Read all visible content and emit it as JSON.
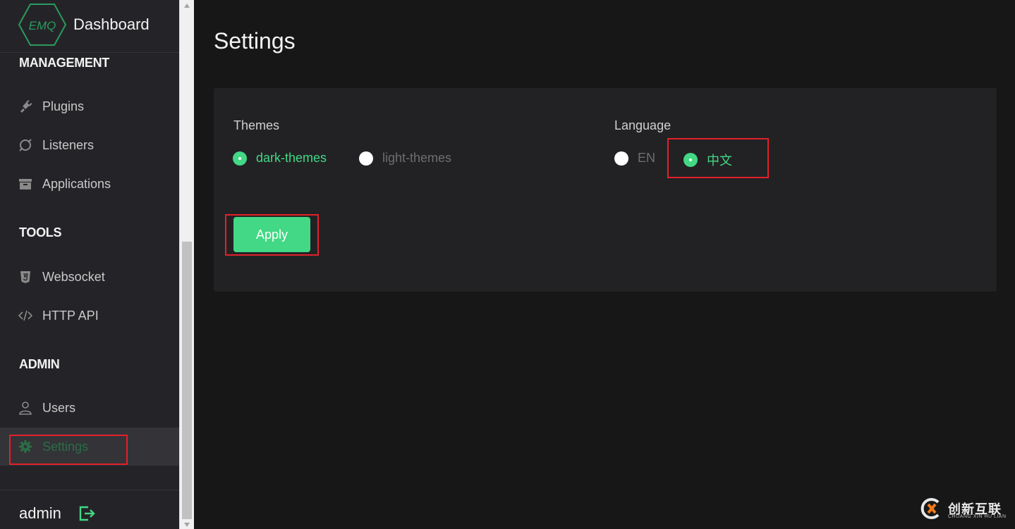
{
  "brand": {
    "logo_text": "EMQ",
    "title": "Dashboard"
  },
  "sidebar": {
    "groups": [
      {
        "title": "MANAGEMENT",
        "items": [
          {
            "label": "Plugins",
            "icon": "plug-icon"
          },
          {
            "label": "Listeners",
            "icon": "listener-icon"
          },
          {
            "label": "Applications",
            "icon": "archive-icon"
          }
        ]
      },
      {
        "title": "TOOLS",
        "items": [
          {
            "label": "Websocket",
            "icon": "html5-icon"
          },
          {
            "label": "HTTP API",
            "icon": "code-icon"
          }
        ]
      },
      {
        "title": "ADMIN",
        "items": [
          {
            "label": "Users",
            "icon": "user-icon"
          },
          {
            "label": "Settings",
            "icon": "gear-icon",
            "active": true
          }
        ]
      }
    ],
    "footer": {
      "username": "admin"
    }
  },
  "main": {
    "title": "Settings",
    "themes": {
      "label": "Themes",
      "options": [
        {
          "label": "dark-themes",
          "selected": true
        },
        {
          "label": "light-themes",
          "selected": false
        }
      ]
    },
    "language": {
      "label": "Language",
      "options": [
        {
          "label": "EN",
          "selected": false
        },
        {
          "label": "中文",
          "selected": true
        }
      ]
    },
    "apply_label": "Apply"
  },
  "watermark": {
    "text": "创新互联",
    "sub": "CHUANG XIN HU LIAN"
  },
  "colors": {
    "accent": "#42d885",
    "sidebar_bg": "#242428",
    "page_bg": "#171717",
    "card_bg": "#222224",
    "highlight": "#e3202a"
  }
}
